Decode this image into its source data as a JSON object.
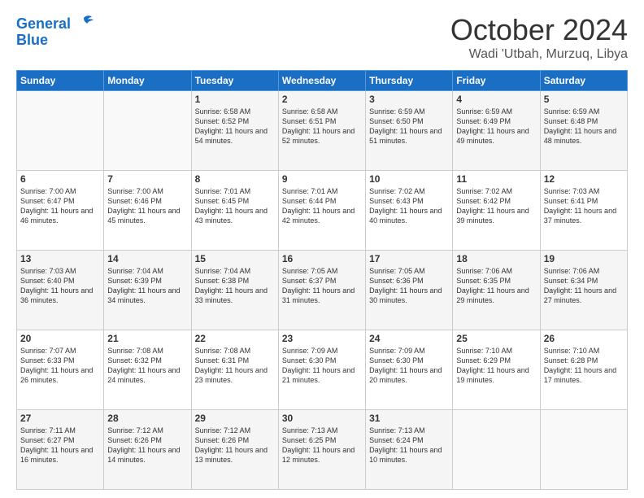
{
  "logo": {
    "line1": "General",
    "line2": "Blue"
  },
  "header": {
    "month": "October 2024",
    "location": "Wadi 'Utbah, Murzuq, Libya"
  },
  "weekdays": [
    "Sunday",
    "Monday",
    "Tuesday",
    "Wednesday",
    "Thursday",
    "Friday",
    "Saturday"
  ],
  "weeks": [
    [
      {
        "day": "",
        "info": ""
      },
      {
        "day": "",
        "info": ""
      },
      {
        "day": "1",
        "info": "Sunrise: 6:58 AM\nSunset: 6:52 PM\nDaylight: 11 hours and 54 minutes."
      },
      {
        "day": "2",
        "info": "Sunrise: 6:58 AM\nSunset: 6:51 PM\nDaylight: 11 hours and 52 minutes."
      },
      {
        "day": "3",
        "info": "Sunrise: 6:59 AM\nSunset: 6:50 PM\nDaylight: 11 hours and 51 minutes."
      },
      {
        "day": "4",
        "info": "Sunrise: 6:59 AM\nSunset: 6:49 PM\nDaylight: 11 hours and 49 minutes."
      },
      {
        "day": "5",
        "info": "Sunrise: 6:59 AM\nSunset: 6:48 PM\nDaylight: 11 hours and 48 minutes."
      }
    ],
    [
      {
        "day": "6",
        "info": "Sunrise: 7:00 AM\nSunset: 6:47 PM\nDaylight: 11 hours and 46 minutes."
      },
      {
        "day": "7",
        "info": "Sunrise: 7:00 AM\nSunset: 6:46 PM\nDaylight: 11 hours and 45 minutes."
      },
      {
        "day": "8",
        "info": "Sunrise: 7:01 AM\nSunset: 6:45 PM\nDaylight: 11 hours and 43 minutes."
      },
      {
        "day": "9",
        "info": "Sunrise: 7:01 AM\nSunset: 6:44 PM\nDaylight: 11 hours and 42 minutes."
      },
      {
        "day": "10",
        "info": "Sunrise: 7:02 AM\nSunset: 6:43 PM\nDaylight: 11 hours and 40 minutes."
      },
      {
        "day": "11",
        "info": "Sunrise: 7:02 AM\nSunset: 6:42 PM\nDaylight: 11 hours and 39 minutes."
      },
      {
        "day": "12",
        "info": "Sunrise: 7:03 AM\nSunset: 6:41 PM\nDaylight: 11 hours and 37 minutes."
      }
    ],
    [
      {
        "day": "13",
        "info": "Sunrise: 7:03 AM\nSunset: 6:40 PM\nDaylight: 11 hours and 36 minutes."
      },
      {
        "day": "14",
        "info": "Sunrise: 7:04 AM\nSunset: 6:39 PM\nDaylight: 11 hours and 34 minutes."
      },
      {
        "day": "15",
        "info": "Sunrise: 7:04 AM\nSunset: 6:38 PM\nDaylight: 11 hours and 33 minutes."
      },
      {
        "day": "16",
        "info": "Sunrise: 7:05 AM\nSunset: 6:37 PM\nDaylight: 11 hours and 31 minutes."
      },
      {
        "day": "17",
        "info": "Sunrise: 7:05 AM\nSunset: 6:36 PM\nDaylight: 11 hours and 30 minutes."
      },
      {
        "day": "18",
        "info": "Sunrise: 7:06 AM\nSunset: 6:35 PM\nDaylight: 11 hours and 29 minutes."
      },
      {
        "day": "19",
        "info": "Sunrise: 7:06 AM\nSunset: 6:34 PM\nDaylight: 11 hours and 27 minutes."
      }
    ],
    [
      {
        "day": "20",
        "info": "Sunrise: 7:07 AM\nSunset: 6:33 PM\nDaylight: 11 hours and 26 minutes."
      },
      {
        "day": "21",
        "info": "Sunrise: 7:08 AM\nSunset: 6:32 PM\nDaylight: 11 hours and 24 minutes."
      },
      {
        "day": "22",
        "info": "Sunrise: 7:08 AM\nSunset: 6:31 PM\nDaylight: 11 hours and 23 minutes."
      },
      {
        "day": "23",
        "info": "Sunrise: 7:09 AM\nSunset: 6:30 PM\nDaylight: 11 hours and 21 minutes."
      },
      {
        "day": "24",
        "info": "Sunrise: 7:09 AM\nSunset: 6:30 PM\nDaylight: 11 hours and 20 minutes."
      },
      {
        "day": "25",
        "info": "Sunrise: 7:10 AM\nSunset: 6:29 PM\nDaylight: 11 hours and 19 minutes."
      },
      {
        "day": "26",
        "info": "Sunrise: 7:10 AM\nSunset: 6:28 PM\nDaylight: 11 hours and 17 minutes."
      }
    ],
    [
      {
        "day": "27",
        "info": "Sunrise: 7:11 AM\nSunset: 6:27 PM\nDaylight: 11 hours and 16 minutes."
      },
      {
        "day": "28",
        "info": "Sunrise: 7:12 AM\nSunset: 6:26 PM\nDaylight: 11 hours and 14 minutes."
      },
      {
        "day": "29",
        "info": "Sunrise: 7:12 AM\nSunset: 6:26 PM\nDaylight: 11 hours and 13 minutes."
      },
      {
        "day": "30",
        "info": "Sunrise: 7:13 AM\nSunset: 6:25 PM\nDaylight: 11 hours and 12 minutes."
      },
      {
        "day": "31",
        "info": "Sunrise: 7:13 AM\nSunset: 6:24 PM\nDaylight: 11 hours and 10 minutes."
      },
      {
        "day": "",
        "info": ""
      },
      {
        "day": "",
        "info": ""
      }
    ]
  ]
}
